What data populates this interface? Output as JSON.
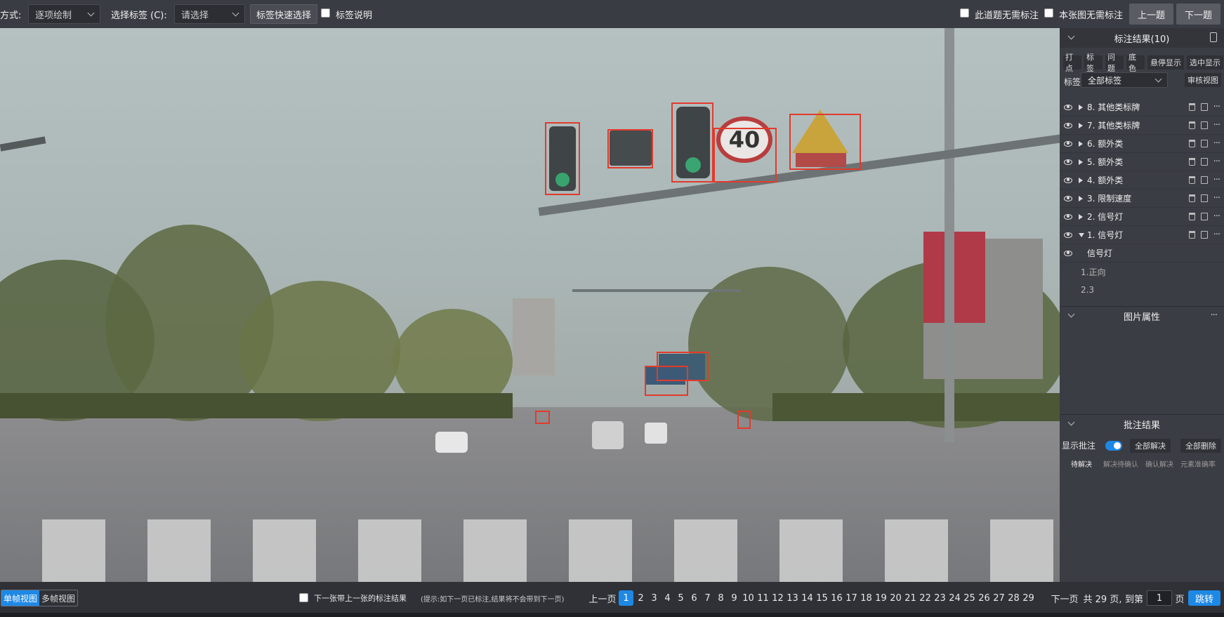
{
  "toolbar": {
    "mode_label": "方式:",
    "mode_value": "逐项绘制",
    "tag_label": "选择标签 (C):",
    "tag_placeholder": "请选择",
    "quick_select": "标签快速选择",
    "tag_desc": "标签说明",
    "no_annot_question": "此道题无需标注",
    "no_annot_image": "本张图无需标注",
    "prev": "上一题",
    "next": "下一题"
  },
  "canvas": {
    "speed_sign": "40"
  },
  "panel": {
    "results_title": "标注结果(10)",
    "mini_buttons": [
      "打点",
      "标签",
      "问题",
      "底色",
      "悬停显示",
      "选中显示"
    ],
    "filter_label": "标签",
    "filter_value": "全部标签",
    "review_view": "审核视图",
    "items": [
      {
        "label": "8. 其他类标牌"
      },
      {
        "label": "7. 其他类标牌"
      },
      {
        "label": "6. 额外类"
      },
      {
        "label": "5. 额外类"
      },
      {
        "label": "4. 额外类"
      },
      {
        "label": "3. 限制速度"
      },
      {
        "label": "2. 信号灯"
      },
      {
        "label": "1. 信号灯"
      }
    ],
    "sub_item": "信号灯",
    "attr1": "1.正向",
    "attr2": "2.3",
    "image_props": "图片属性",
    "comments_title": "批注结果",
    "show_comments": "显示批注",
    "resolve_all": "全部解决",
    "delete_all": "全部删除",
    "tabs": [
      "待解决",
      "解决待确认",
      "确认解决",
      "元素准确率"
    ]
  },
  "bottom": {
    "single_view": "单帧视图",
    "multi_view": "多帧视图",
    "carry_over": "下一张带上一张的标注结果",
    "hint": "(提示:如下一页已标注,结果将不会带到下一页)",
    "prev_page": "上一页",
    "pages": [
      "1",
      "2",
      "3",
      "4",
      "5",
      "6",
      "7",
      "8",
      "9",
      "10",
      "11",
      "12",
      "13",
      "14",
      "15",
      "16",
      "17",
      "18",
      "19",
      "20",
      "21",
      "22",
      "23",
      "24",
      "25",
      "26",
      "27",
      "28",
      "29"
    ],
    "next_page": "下一页",
    "total": "共 29 页,",
    "goto_label": "到第",
    "goto_value": "1",
    "page_unit": "页",
    "jump": "跳转"
  },
  "colors": {
    "accent": "#1e88e5",
    "box": "#e23a2c"
  }
}
